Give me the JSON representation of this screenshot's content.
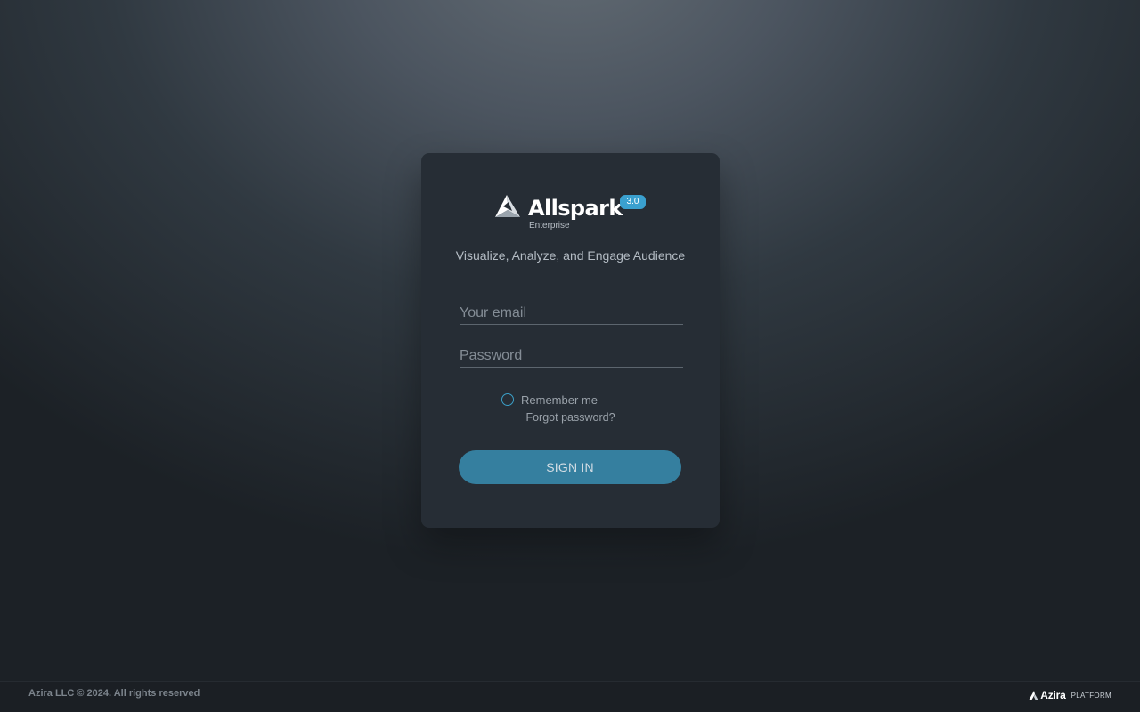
{
  "login": {
    "brand_name": "Allspark",
    "edition": "Enterprise",
    "version": "3.0",
    "tagline": "Visualize, Analyze, and Engage Audience",
    "email_placeholder": "Your email",
    "password_placeholder": "Password",
    "remember_label": "Remember me",
    "remember_checked": false,
    "forgot_label": "Forgot password?",
    "signin_label": "SIGN IN"
  },
  "footer": {
    "copyright": "Azira LLC © 2024. All rights reserved",
    "brand_name": "Azira",
    "brand_suffix": "PLATFORM"
  },
  "colors": {
    "accent": "#3aa0cf",
    "button": "#357f9f",
    "card": "#262d35"
  },
  "icons": {
    "logo": "allspark-logo-icon",
    "footer_logo": "azira-logo-icon",
    "remember": "radio-circle-icon"
  }
}
